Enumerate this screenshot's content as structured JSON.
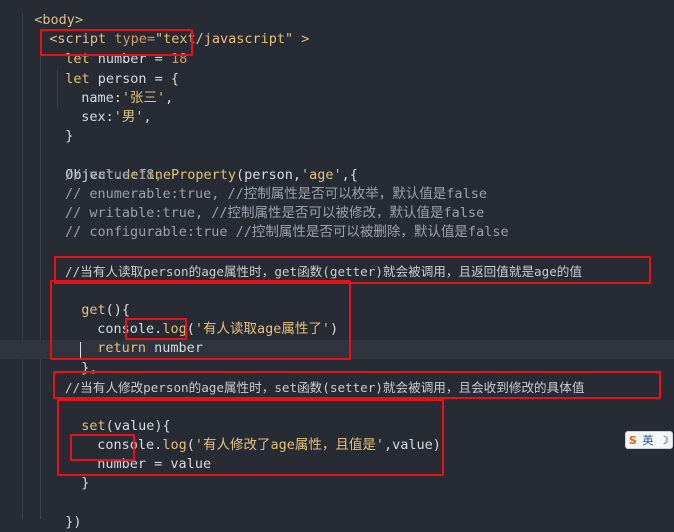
{
  "lines": {
    "l0": "<body>",
    "l1_open": "<",
    "l1_tag": "script",
    "l1_attr": " type=",
    "l1_str": "\"text/javascript\"",
    "l1_close": " >",
    "l2_kw": "let",
    "l2_rest": " number = ",
    "l2_num": "18",
    "l3_kw": "let",
    "l3_rest": " person = {",
    "l4_prop": "name:",
    "l4_str": "'张三'",
    "l4_end": ",",
    "l5_prop": "sex:",
    "l5_str": "'男'",
    "l5_end": ",",
    "l6": "}",
    "l8_obj": "Object",
    "l8_dot": ".",
    "l8_fn": "defineProperty",
    "l8_args": "(person,",
    "l8_str": "'age'",
    "l8_end": ",{",
    "l9": "// value:18,",
    "l10": "// enumerable:true, //控制属性是否可以枚举，默认值是false",
    "l11": "// writable:true, //控制属性是否可以被修改，默认值是false",
    "l12": "// configurable:true //控制属性是否可以被删除，默认值是false",
    "l14": "//当有人读取person的age属性时，get函数(getter)就会被调用，且返回值就是age的值",
    "l15_fn": "get",
    "l15_rest": "(){",
    "l16_obj": "console",
    "l16_dot": ".",
    "l16_fn": "log",
    "l16_open": "(",
    "l16_str": "'有人读取age属性了'",
    "l16_close": ")",
    "l17_kw": "return",
    "l17_rest": " number",
    "l18": "},",
    "l20": "//当有人修改person的age属性时，set函数(setter)就会被调用，且会收到修改的具体值",
    "l21_fn": "set",
    "l21_rest": "(value){",
    "l22_obj": "console",
    "l22_dot": ".",
    "l22_fn": "log",
    "l22_open": "(",
    "l22_str": "'有人修改了age属性，且值是'",
    "l22_close": ",value)",
    "l23_a": "number",
    "l23_b": " = value",
    "l24": "}",
    "l26": "})"
  },
  "ime": {
    "icon": "S",
    "label": "英",
    "moon": "☽"
  },
  "colors": {
    "background": "#272c34",
    "highlight_box": "#e8111a",
    "keyword": "#e5c07b",
    "number": "#d19a66",
    "comment": "#9aa1ac"
  }
}
